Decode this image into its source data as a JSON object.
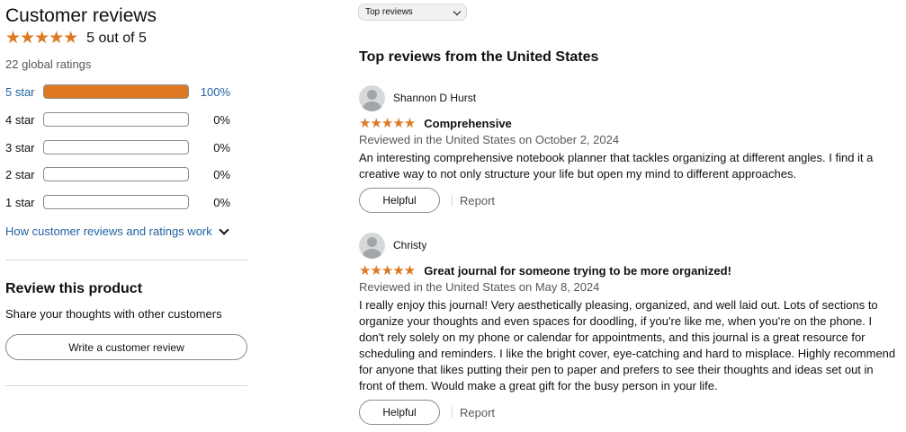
{
  "summary": {
    "title": "Customer reviews",
    "stars": "★★★★★",
    "average_text": "5 out of 5",
    "global_ratings": "22 global ratings",
    "histogram": [
      {
        "label": "5 star",
        "percent_text": "100%",
        "fraction": 1.0
      },
      {
        "label": "4 star",
        "percent_text": "0%",
        "fraction": 0.0
      },
      {
        "label": "3 star",
        "percent_text": "0%",
        "fraction": 0.0
      },
      {
        "label": "2 star",
        "percent_text": "0%",
        "fraction": 0.0
      },
      {
        "label": "1 star",
        "percent_text": "0%",
        "fraction": 0.0
      }
    ],
    "how_link": "How customer reviews and ratings work"
  },
  "review_product": {
    "title": "Review this product",
    "subtitle": "Share your thoughts with other customers",
    "button": "Write a customer review"
  },
  "sort": {
    "selected": "Top reviews"
  },
  "top_reviews_title": "Top reviews from the United States",
  "reviews": [
    {
      "name": "Shannon D Hurst",
      "stars": "★★★★★",
      "title": "Comprehensive",
      "date": "Reviewed in the United States on October 2, 2024",
      "body": "An interesting comprehensive notebook planner that tackles organizing at different angles. I find it a creative way to not only structure your life but open my mind to different approaches.",
      "helpful": "Helpful",
      "report": "Report"
    },
    {
      "name": "Christy",
      "stars": "★★★★★",
      "title": "Great journal for someone trying to be more organized!",
      "date": "Reviewed in the United States on May 8, 2024",
      "body": "I really enjoy this journal! Very aesthetically pleasing, organized, and well laid out. Lots of sections to organize your thoughts and even spaces for doodling, if you're like me, when you're on the phone. I don't rely solely on my phone or calendar for appointments, and this journal is a great resource for scheduling and reminders. I like the bright cover, eye-catching and hard to misplace. Highly recommend for anyone that likes putting their pen to paper and prefers to see their thoughts and ideas set out in front of them. Would make a great gift for the busy person in your life.",
      "helpful": "Helpful",
      "report": "Report"
    }
  ],
  "colors": {
    "star": "#de7921",
    "link": "#2162a1",
    "muted": "#565959",
    "border": "#888c8c"
  }
}
